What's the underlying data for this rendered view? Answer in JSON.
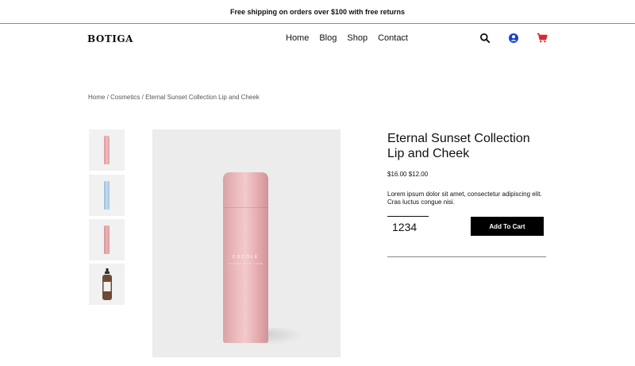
{
  "announcement": "Free shipping on orders over $100 with free returns",
  "header": {
    "logo": "BOTIGA",
    "nav": [
      "Home",
      "Blog",
      "Shop",
      "Contact"
    ],
    "icons": {
      "search": "search-icon",
      "account": "account-icon",
      "cart": "cart-icon"
    },
    "colors": {
      "account": "#1a3fd6",
      "cart": "#e0242b"
    }
  },
  "breadcrumb": {
    "items": [
      "Home",
      "Cosmetics",
      "Eternal Sunset Collection Lip and Cheek"
    ],
    "separator": "/"
  },
  "gallery": {
    "thumbnails": [
      {
        "name": "pink bottle",
        "color": "#e7a9ab"
      },
      {
        "name": "blue bottle",
        "color": "#a9c6e2"
      },
      {
        "name": "pink bottle",
        "color": "#dea0a3"
      },
      {
        "name": "pump bottle",
        "color": "#6b4a37"
      }
    ],
    "main": {
      "brand": "COCOLE",
      "subtext": "LUXURY SKIN CARE"
    }
  },
  "product": {
    "title_line1": "Eternal Sunset Collection",
    "title_line2": "Lip and Cheek",
    "price": "$16.00 $12.00",
    "description": "Lorem ipsum dolor sit amet, consectetur adipiscing elit. Cras luctus congue nisi.",
    "quantity": "1234",
    "add_to_cart": "Add To Cart"
  }
}
